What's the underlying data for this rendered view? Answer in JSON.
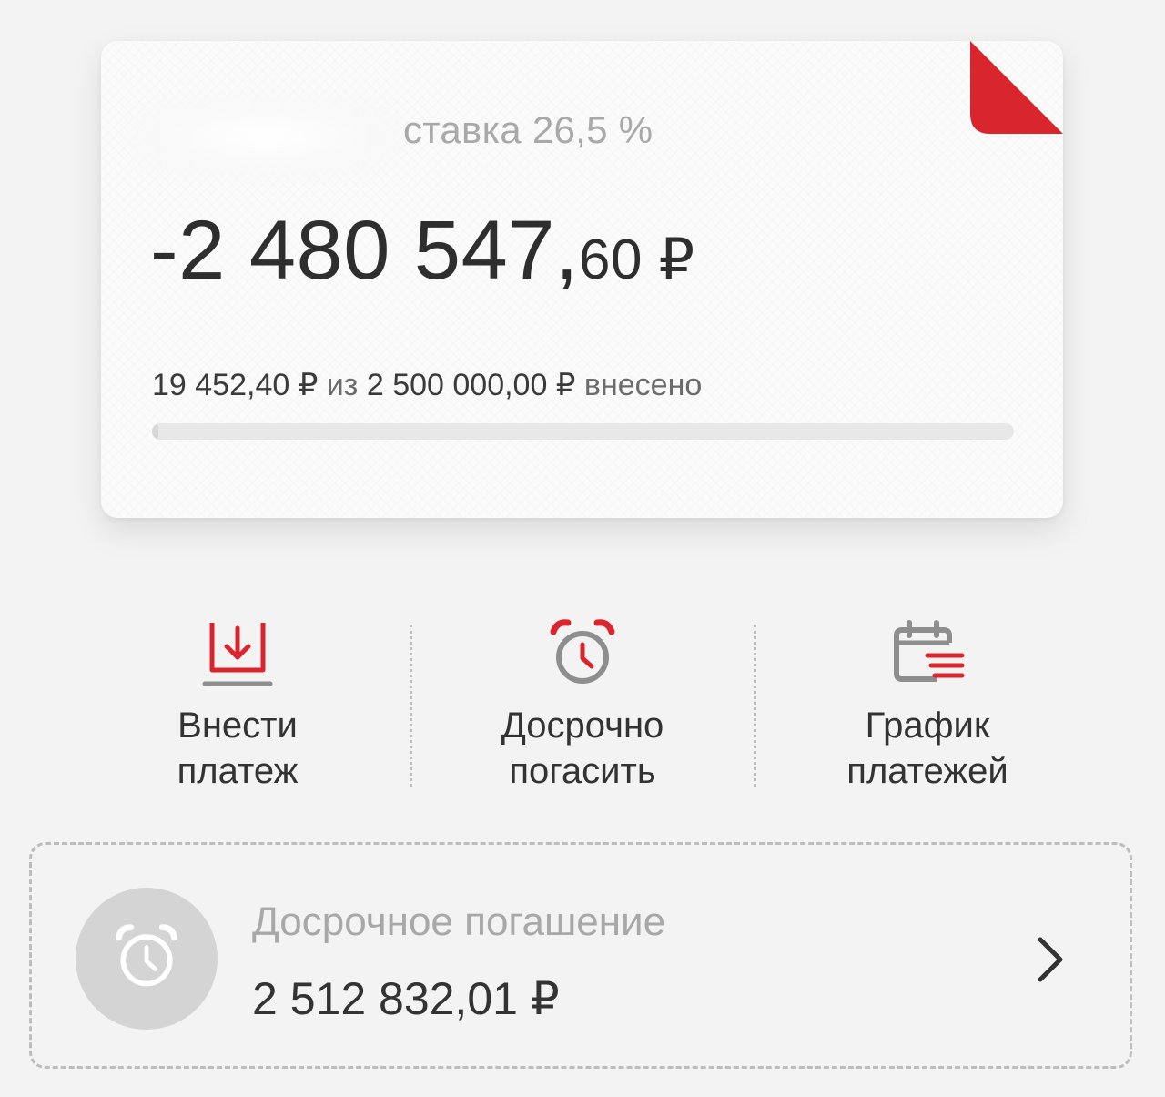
{
  "loan": {
    "rate_label": "ставка 26,5 %",
    "balance_main": "-2 480 547,",
    "balance_cents": "60 ₽",
    "paid_amount": "19 452,40 ₽",
    "paid_from": "из",
    "total_amount": "2 500 000,00 ₽",
    "paid_suffix": "внесено",
    "paid_fraction": 0.0078,
    "accent_color": "#d9262e"
  },
  "actions": [
    {
      "label_line1": "Внести",
      "label_line2": "платеж",
      "icon": "download-tray-icon"
    },
    {
      "label_line1": "Досрочно",
      "label_line2": "погасить",
      "icon": "alarm-clock-icon"
    },
    {
      "label_line1": "График",
      "label_line2": "платежей",
      "icon": "calendar-list-icon"
    }
  ],
  "early_repayment": {
    "title": "Досрочное погашение",
    "amount": "2 512 832,01 ₽",
    "icon": "alarm-clock-icon",
    "chevron": "chevron-right-icon"
  }
}
